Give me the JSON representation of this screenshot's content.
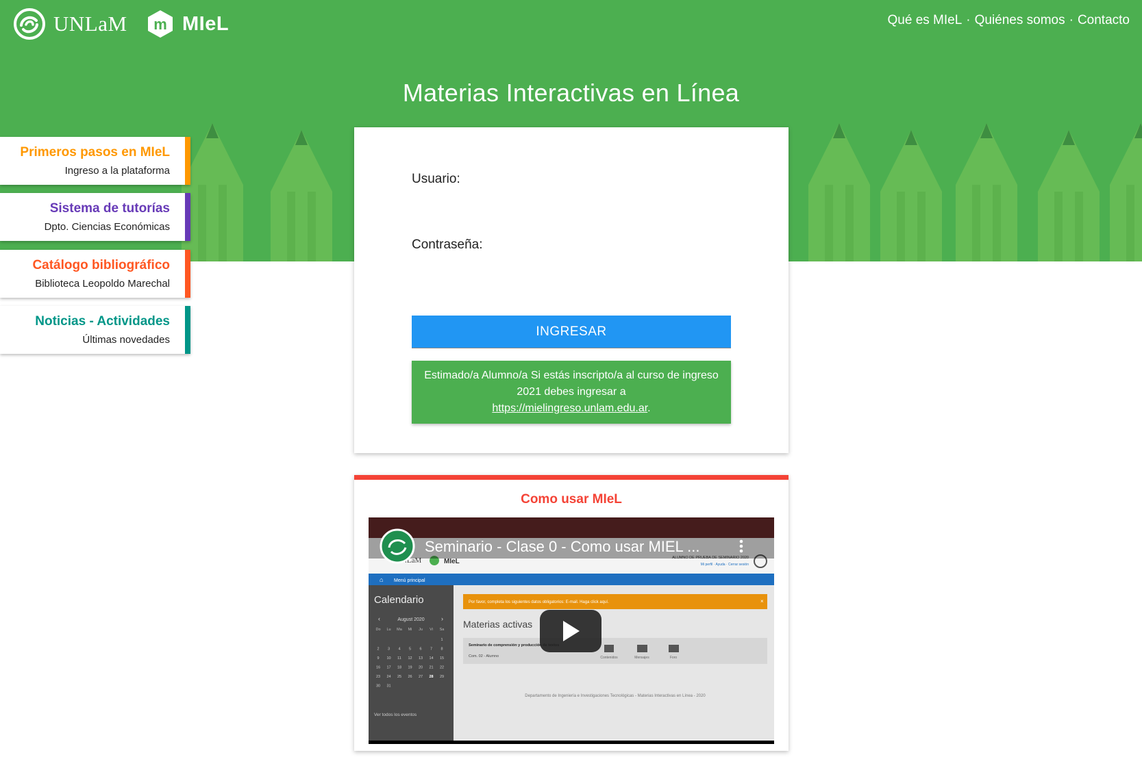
{
  "header": {
    "brand_unlam": "UNLaM",
    "brand_miel": "MIeL",
    "miel_mark": "m",
    "nav": [
      "Qué es MIeL",
      "Quiénes somos",
      "Contacto"
    ],
    "nav_separator": "·",
    "title": "Materias Interactivas en Línea"
  },
  "side_cards": [
    {
      "title": "Primeros pasos en MIeL",
      "subtitle": "Ingreso a la plataforma",
      "color": "#ff9800"
    },
    {
      "title": "Sistema de tutorías",
      "subtitle": "Dpto. Ciencias Económicas",
      "color": "#673ab7"
    },
    {
      "title": "Catálogo bibliográfico",
      "subtitle": "Biblioteca Leopoldo Marechal",
      "color": "#ff5722"
    },
    {
      "title": "Noticias - Actividades",
      "subtitle": "Últimas novedades",
      "color": "#009688"
    }
  ],
  "login": {
    "user_label": "Usuario:",
    "user_value": "",
    "password_label": "Contraseña:",
    "password_value": "",
    "submit_label": "INGRESAR",
    "notice_text": "Estimado/a Alumno/a Si estás inscripto/a al curso de ingreso 2021 debes ingresar a",
    "notice_link": "https://mielingreso.unlam.edu.ar",
    "notice_end": "."
  },
  "video": {
    "section_title": "Como usar MIeL",
    "video_title": "Seminario - Clase 0 - Como usar MIEL ...",
    "inner": {
      "user_line": "ALUMNO DE PRUEBA DE SEMINARIO 2020",
      "user_links": "Mi perfil · Ayuda · Cerrar sesión",
      "menu": "Menú principal",
      "calendar_title": "Calendario",
      "month": "August 2020",
      "weekdays": [
        "Do",
        "Lu",
        "Ma",
        "Mi",
        "Ju",
        "Vi",
        "Sa"
      ],
      "weeks": [
        [
          "",
          "",
          "",
          "",
          "",
          "",
          "1"
        ],
        [
          "2",
          "3",
          "4",
          "5",
          "6",
          "7",
          "8"
        ],
        [
          "9",
          "10",
          "11",
          "12",
          "13",
          "14",
          "15"
        ],
        [
          "16",
          "17",
          "18",
          "19",
          "20",
          "21",
          "22"
        ],
        [
          "23",
          "24",
          "25",
          "26",
          "27",
          "28",
          "29"
        ],
        [
          "30",
          "31",
          "",
          "",
          "",
          "",
          ""
        ]
      ],
      "events_link": "Ver todos los eventos",
      "alert": "Por favor, completa los siguientes datos obligatorios: E-mail. Haga click aquí.",
      "active_title": "Materias activas",
      "course": "Seminario de comprensión y producción de textos",
      "course_sub": "Com. 02 - Alumno",
      "icon_labels": [
        "Contenidos",
        "Mensajes",
        "Foro"
      ],
      "footer": "Departamento de Ingeniería e Investigaciones Tecnológicas - Materias Interactivas en Línea - 2020"
    }
  },
  "colors": {
    "hero_green": "#4caf50",
    "pencil_green": "#66bb55",
    "button_blue": "#2196f3",
    "video_red": "#f44336",
    "inner_blue": "#1e6fc0",
    "inner_orange": "#e8920c"
  },
  "icons": [
    "unlam-swirl-icon",
    "miel-logo-icon",
    "play-icon",
    "home-icon",
    "book-icon",
    "envelope-icon",
    "chat-icon",
    "user-icon",
    "kebab-icon"
  ]
}
